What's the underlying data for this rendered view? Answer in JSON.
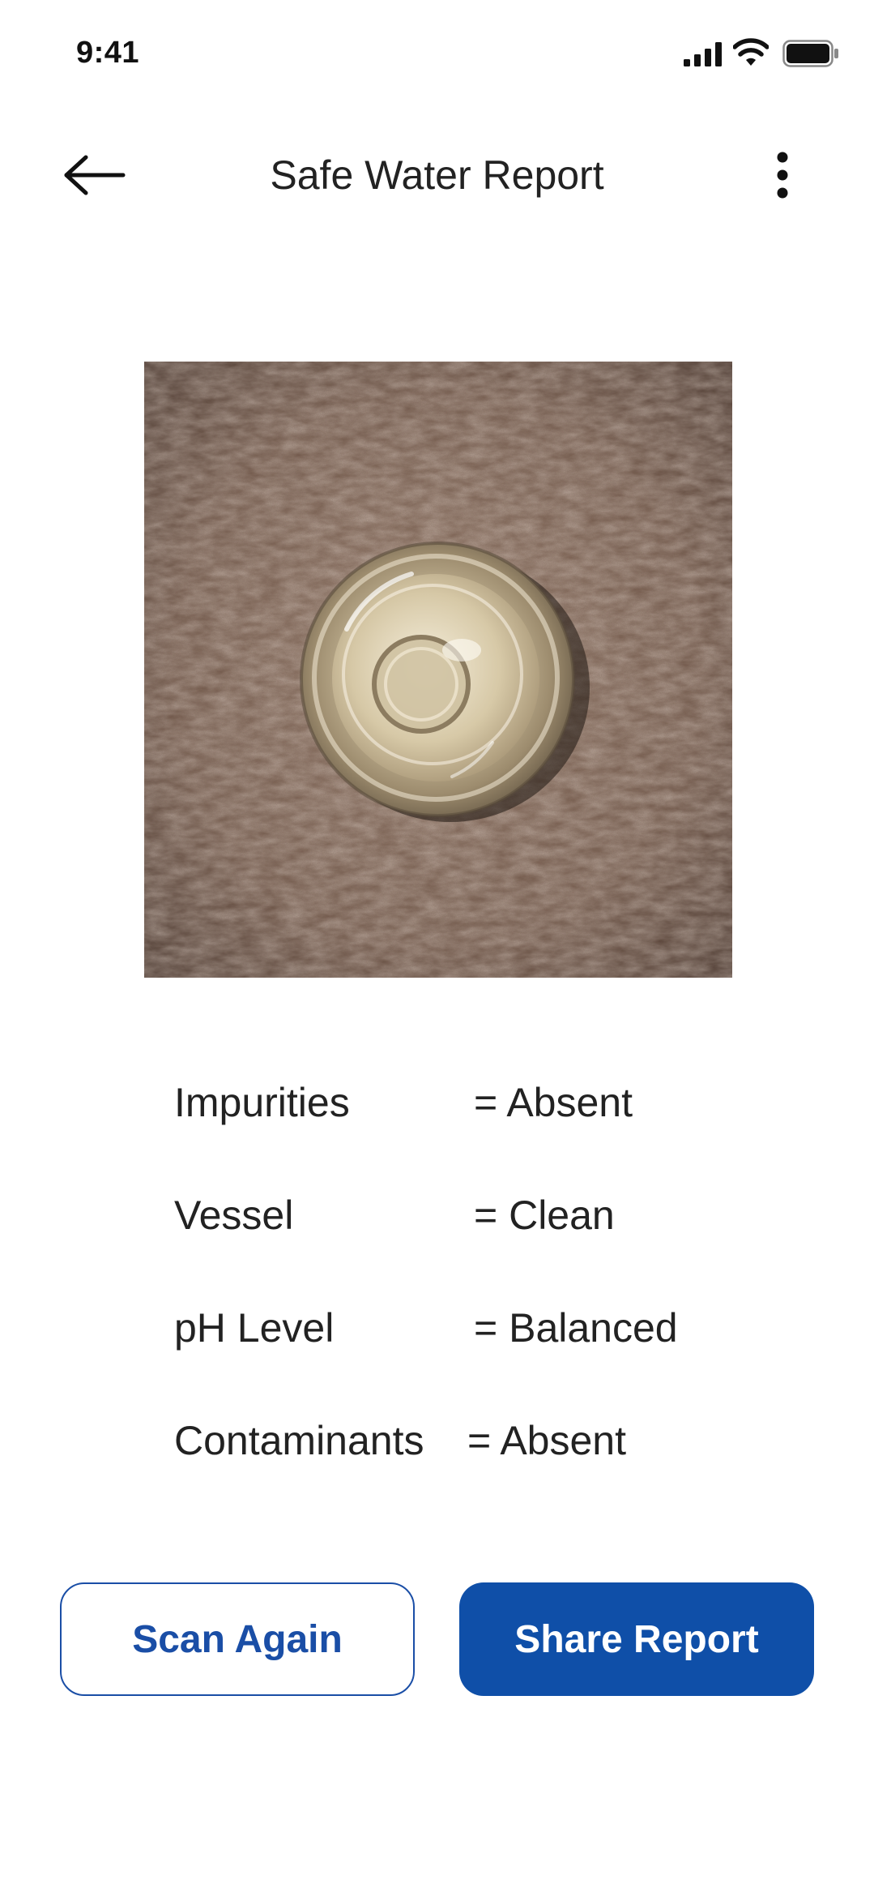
{
  "status_bar": {
    "time": "9:41"
  },
  "header": {
    "title": "Safe Water Report",
    "back_icon": "arrow-left-icon",
    "more_icon": "more-vertical-icon"
  },
  "photo": {
    "subject": "glass-of-water-top-view"
  },
  "results": [
    {
      "label": "Impurities",
      "value": "= Absent"
    },
    {
      "label": "Vessel",
      "value": "= Clean"
    },
    {
      "label": "pH Level",
      "value": "= Balanced"
    },
    {
      "label": "Contaminants",
      "value": "= Absent"
    }
  ],
  "actions": {
    "scan_again_label": "Scan Again",
    "share_report_label": "Share Report"
  },
  "colors": {
    "primary": "#0f4fa8",
    "text": "#222222",
    "background": "#ffffff"
  }
}
